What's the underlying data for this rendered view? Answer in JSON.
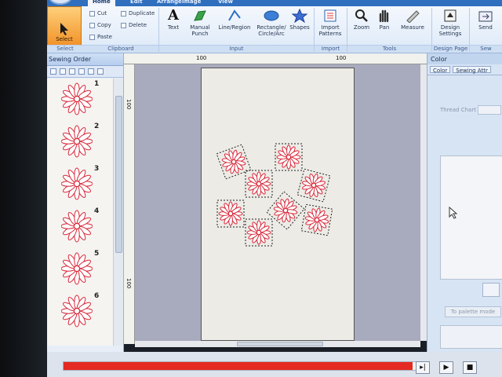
{
  "ribbon": {
    "tabs": [
      "Home",
      "Edit",
      "Arrange",
      "Image",
      "View"
    ],
    "select_label": "Select",
    "clipboard": {
      "cut": "Cut",
      "copy": "Copy",
      "paste": "Paste",
      "duplicate": "Duplicate",
      "delete": "Delete"
    },
    "input": {
      "text": "Text",
      "manual_punch": "Manual Punch",
      "line_region": "Line/Region",
      "rect_circle_arc": "Rectangle/ Circle/Arc",
      "shapes": "Shapes"
    },
    "import": {
      "import_patterns": "Import Patterns"
    },
    "tools": {
      "zoom": "Zoom",
      "pan": "Pan",
      "measure": "Measure"
    },
    "design_page": {
      "design_settings": "Design Settings"
    },
    "sew": {
      "send": "Send"
    },
    "group_labels": {
      "select": "Select",
      "clipboard": "Clipboard",
      "input": "Input",
      "import": "Import",
      "tools": "Tools",
      "design_page": "Design Page",
      "sew": "Sew"
    }
  },
  "sewing_order": {
    "title": "Sewing Order",
    "items": [
      "1",
      "2",
      "3",
      "4",
      "5",
      "6"
    ]
  },
  "rulers": {
    "top_a": "100",
    "top_b": "100",
    "left_a": "100",
    "left_b": "100"
  },
  "color_panel": {
    "title": "Color",
    "tabs": [
      "Color",
      "Sewing Attr"
    ],
    "thread_chart_label": "Thread Chart",
    "palette_button": "To palette mode"
  },
  "colors": {
    "flower": "#d8283a",
    "accent": "#2f6fbe",
    "progress": "#e42a22"
  },
  "progress": {
    "fraction": 0.98
  },
  "playback": {
    "step": "▸|",
    "play": "▶",
    "stop": "■"
  }
}
